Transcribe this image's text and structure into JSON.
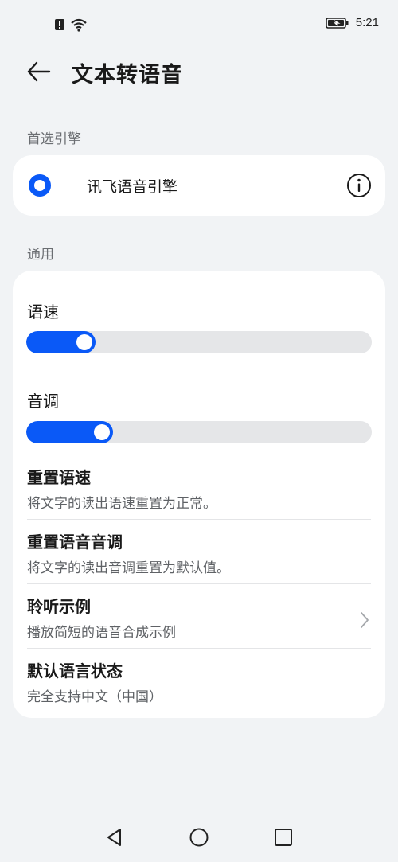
{
  "status_bar": {
    "time": "5:21",
    "icons": [
      "alert-icon",
      "wifi-icon",
      "battery-charging-icon"
    ]
  },
  "header": {
    "title": "文本转语音",
    "back_icon": "arrow-left-icon"
  },
  "preferred_engine": {
    "section_label": "首选引擎",
    "engine_name": "讯飞语音引擎",
    "selected": true,
    "info_icon": "info-icon"
  },
  "general": {
    "section_label": "通用",
    "speech_rate": {
      "label": "语速",
      "value_fraction": 0.2
    },
    "pitch": {
      "label": "音调",
      "value_fraction": 0.25
    },
    "items": [
      {
        "title": "重置语速",
        "subtitle": "将文字的读出语速重置为正常。"
      },
      {
        "title": "重置语音音调",
        "subtitle": "将文字的读出音调重置为默认值。"
      },
      {
        "title": "聆听示例",
        "subtitle": "播放简短的语音合成示例",
        "chevron": "chevron-right-icon"
      },
      {
        "title": "默认语言状态",
        "subtitle": "完全支持中文（中国）"
      }
    ]
  },
  "nav_bar": {
    "icons": [
      "back-triangle-icon",
      "home-circle-icon",
      "recents-square-icon"
    ]
  },
  "colors": {
    "accent": "#0a59f7",
    "background": "#f1f3f5",
    "card": "#ffffff"
  }
}
